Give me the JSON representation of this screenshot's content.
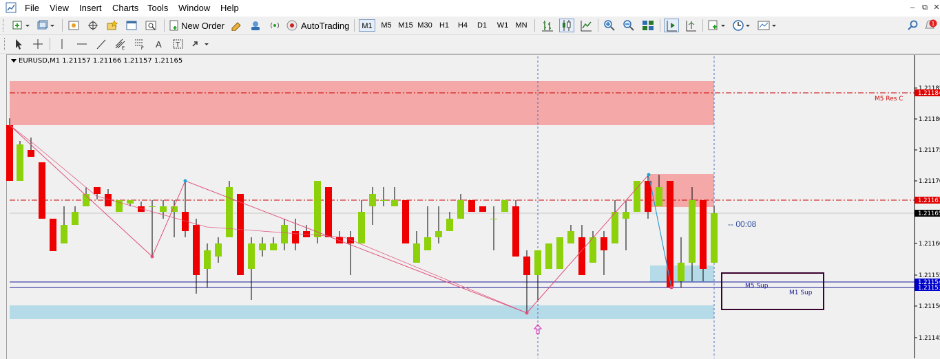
{
  "menu": {
    "items": [
      "File",
      "View",
      "Insert",
      "Charts",
      "Tools",
      "Window",
      "Help"
    ]
  },
  "toolbar": {
    "new_order_label": "New Order",
    "autotrading_label": "AutoTrading",
    "timeframes": [
      "M1",
      "M5",
      "M15",
      "M30",
      "H1",
      "H4",
      "D1",
      "W1",
      "MN"
    ],
    "active_timeframe": "M1"
  },
  "chart": {
    "header": "EURUSD,M1  1.21157 1.21166 1.21157 1.21165",
    "timer": "-- 00:08",
    "price_axis_labels": [
      "1.21185",
      "1.21180",
      "1.21175",
      "1.21170",
      "1.21165",
      "1.21160",
      "1.21155",
      "1.21150",
      "1.21145"
    ],
    "level_labels": {
      "m5_res_c": "M5 Res C",
      "m5_sup": "M5 Sup",
      "m1_sup": "M1 Sup"
    },
    "price_tags": [
      {
        "value": "1.21184",
        "color": "#e00000"
      },
      {
        "value": "1.21167",
        "color": "#e00000"
      },
      {
        "value": "1.21165",
        "color": "#000000"
      },
      {
        "value": "1.21154",
        "color": "#0000cc"
      },
      {
        "value": "1.21153",
        "color": "#0000cc"
      }
    ],
    "colors": {
      "bull": "#8cd10a",
      "bear": "#ee0000",
      "resistance_zone": "#f4a8a8",
      "support_zone": "#b5dbe8",
      "zigzag": "#e0507a",
      "level_line": "#1a1a9a",
      "res_line": "#cc0000",
      "box": "#3a0030"
    }
  }
}
